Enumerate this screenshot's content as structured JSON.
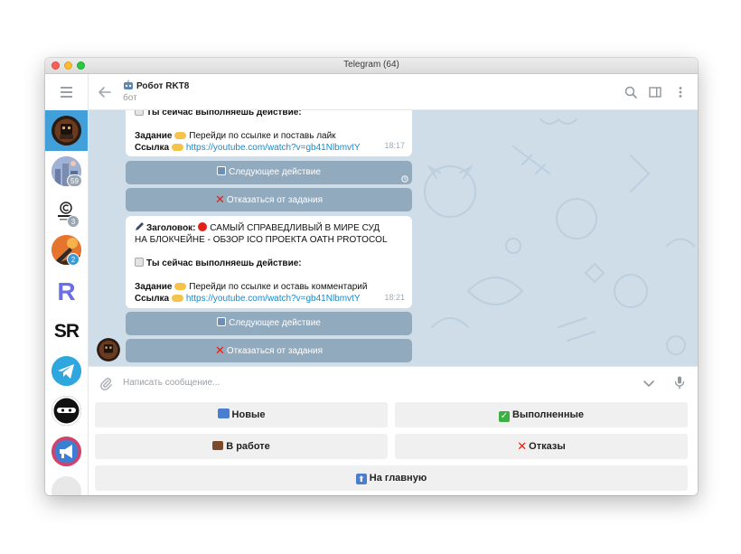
{
  "window": {
    "title": "Telegram (64)"
  },
  "sidebar": {
    "chats": [
      {
        "name": "robot-rkt8",
        "badge": ""
      },
      {
        "name": "chat-2",
        "badge": "59"
      },
      {
        "name": "chat-3",
        "badge": "3"
      },
      {
        "name": "chat-4",
        "badge": "2"
      },
      {
        "name": "chat-5",
        "badge": ""
      },
      {
        "name": "chat-6",
        "badge": ""
      },
      {
        "name": "chat-7",
        "badge": ""
      },
      {
        "name": "chat-8",
        "badge": ""
      },
      {
        "name": "chat-9",
        "badge": ""
      }
    ],
    "sr_logo_text": "SR",
    "r_logo_text": "R",
    "badge_color": "#9aa7b3",
    "unread_color": "#3a9ad9"
  },
  "header": {
    "title": "Робот RKT8",
    "subtitle": "бот"
  },
  "messages": [
    {
      "partial_top": "Ты сейчас выполняешь действие:",
      "task_label": "Задание",
      "task_text": "Перейди по ссылке и поставь лайк",
      "link_label": "Ссылка",
      "link": "https://youtube.com/watch?v=gb41NlbmvtY",
      "time": "18:17"
    },
    {
      "heading_label": "Заголовок:",
      "heading_text": "САМЫЙ СПРАВЕДЛИВЫЙ В МИРЕ СУД НА БЛОКЧЕЙНЕ - ОБЗОР ICO ПРОЕКТА OATH PROTOCOL",
      "action_text": "Ты сейчас выполняешь действие:",
      "task_label": "Задание",
      "task_text": "Перейди по ссылке и оставь комментарий",
      "link_label": "Ссылка",
      "link": "https://youtube.com/watch?v=gb41NlbmvtY",
      "time": "18:21"
    }
  ],
  "inline_buttons": {
    "next": "Следующее действие",
    "refuse": "Отказаться от задания"
  },
  "composer": {
    "placeholder": "Написать сообщение..."
  },
  "reply_keyboard": {
    "new": "Новые",
    "done": "Выполненные",
    "in_progress": "В работе",
    "refusals": "Отказы",
    "home": "На главную"
  },
  "colors": {
    "accent": "#419fd9",
    "link": "#168acd",
    "chat_bg": "#cfdde9",
    "inline_btn": "#7e98ad"
  }
}
